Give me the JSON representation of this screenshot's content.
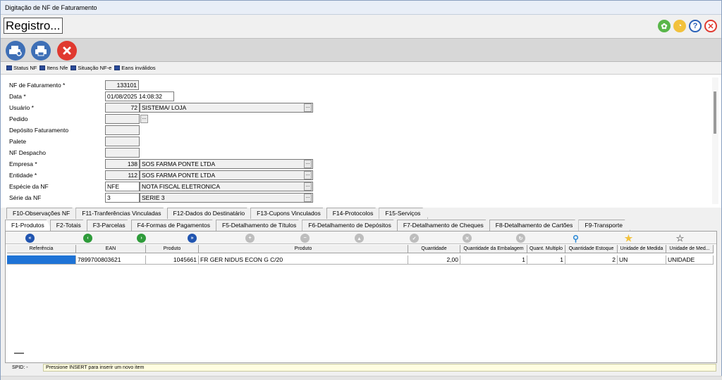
{
  "window": {
    "title": "Digitação de NF de Faturamento"
  },
  "header": {
    "registro": "Registro..."
  },
  "top_icons": [
    "settings-icon",
    "clock-icon",
    "help-icon",
    "close-icon"
  ],
  "toolbar": {
    "buttons": [
      "preview-print-icon",
      "print-icon",
      "cancel-icon"
    ]
  },
  "links": [
    "Status NF",
    "Itens Nfe",
    "Situação NF-e",
    "Eans inválidos"
  ],
  "form": {
    "nf_faturamento_label": "NF de Faturamento *",
    "nf_faturamento": "133101",
    "data_label": "Data *",
    "data": "01/08/2025 14:08:32",
    "usuario_label": "Usuário *",
    "usuario_code": "72",
    "usuario_name": "SISTEMA/ LOJA",
    "pedido_label": "Pedido",
    "deposito_label": "Depósito Faturamento",
    "palete_label": "Palete",
    "nf_despacho_label": "NF Despacho",
    "empresa_label": "Empresa *",
    "empresa_code": "138",
    "empresa_name": "SOS FARMA PONTE LTDA",
    "entidade_label": "Entidade *",
    "entidade_code": "112",
    "entidade_name": "SOS FARMA PONTE LTDA",
    "especie_label": "Espécie da NF",
    "especie_code": "NFE",
    "especie_name": "NOTA FISCAL ELETRONICA",
    "serie_label": "Série da NF",
    "serie_code": "3",
    "serie_name": "SERIE 3",
    "ellipsis": "..."
  },
  "tabs_row1": [
    "F10-Observações NF",
    "F11-Tranferências Vinculadas",
    "F12-Dados do Destinatário",
    "F13-Cupons Vinculados",
    "F14-Protocolos",
    "F15-Serviços"
  ],
  "tabs_row2": [
    "F1-Produtos",
    "F2-Totais",
    "F3-Parcelas",
    "F4-Formas de Pagamentos",
    "F5-Detalhamento de Títulos",
    "F6-Detalhamento de Depósitos",
    "F7-Detalhamento de Cheques",
    "F8-Detalhamento de Cartões",
    "F9-Transporte"
  ],
  "grid": {
    "columns": [
      "Referência",
      "EAN",
      "Produto",
      "Produto",
      "Quantidade",
      "Quantidade da Embalagem",
      "Quant. Multiplo",
      "Quantidade  Estoque",
      "Unidade de Medida",
      "Unidade de Med..."
    ],
    "rows": [
      [
        "",
        "7899700803621",
        "1045661",
        "FR GER NIDUS ECON G C/20",
        "2,00",
        "1",
        "1",
        "2",
        "UN",
        "UNIDADE"
      ]
    ]
  },
  "status": {
    "spid": "SPID: -",
    "message": "Pressione INSERT para inserir um novo item"
  },
  "colors": {
    "accent": "#1e73d6",
    "green": "#2e9b3a",
    "red": "#e0392f",
    "blue": "#2155b0"
  }
}
